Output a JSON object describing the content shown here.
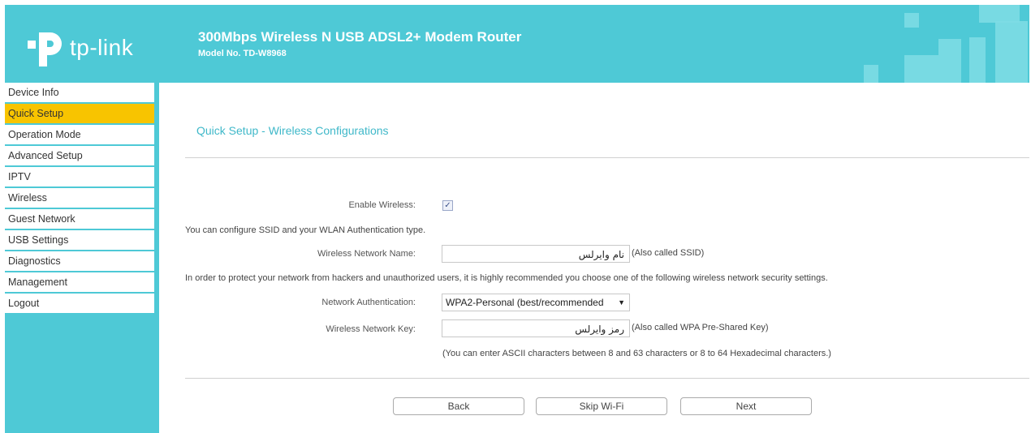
{
  "brand": {
    "logo_text": "tp-link",
    "color": "#4ec9d6",
    "accent": "#f8c400"
  },
  "header": {
    "title": "300Mbps Wireless N USB ADSL2+ Modem Router",
    "model": "Model No. TD-W8968"
  },
  "sidebar": {
    "items": [
      {
        "label": "Device Info"
      },
      {
        "label": "Quick Setup",
        "active": true
      },
      {
        "label": "Operation Mode"
      },
      {
        "label": "Advanced Setup"
      },
      {
        "label": "IPTV"
      },
      {
        "label": "Wireless"
      },
      {
        "label": "Guest Network"
      },
      {
        "label": "USB Settings"
      },
      {
        "label": "Diagnostics"
      },
      {
        "label": "Management"
      },
      {
        "label": "Logout"
      }
    ]
  },
  "main": {
    "title": "Quick Setup - Wireless Configurations",
    "enable_wireless_label": "Enable Wireless:",
    "enable_wireless_checked": true,
    "ssid_intro": "You can configure SSID and your WLAN Authentication type.",
    "ssid_label": "Wireless Network Name:",
    "ssid_value": "نام وایرلس",
    "ssid_note": "(Also called SSID)",
    "security_intro": "In order to protect your network from hackers and unauthorized users, it is highly recommended you choose one of the following wireless network security settings.",
    "auth_label": "Network Authentication:",
    "auth_value": "WPA2-Personal (best/recommended",
    "key_label": "Wireless Network Key:",
    "key_value": "رمز وایرلس",
    "key_note": "(Also called WPA Pre-Shared Key)",
    "key_hint": "(You can enter ASCII characters between 8 and 63 characters or 8 to 64 Hexadecimal characters.)"
  },
  "buttons": {
    "back": "Back",
    "skip": "Skip Wi-Fi",
    "next": "Next"
  }
}
